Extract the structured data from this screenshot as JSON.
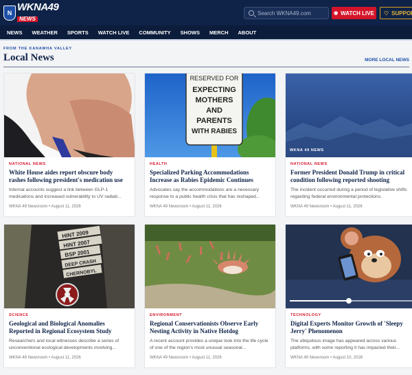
{
  "header": {
    "logo_main": "WKNA49",
    "logo_sub": "NEWS",
    "logo_shield": "N",
    "search_placeholder": "Search WKNA49.com",
    "search_icon": "search-icon",
    "live_label": "WATCH LIVE",
    "live_icon": "broadcast-icon",
    "support_label": "SUPPORT",
    "support_icon": "heart-icon"
  },
  "nav": {
    "items": [
      "NEWS",
      "WEATHER",
      "SPORTS",
      "WATCH LIVE",
      "COMMUNITY",
      "SHOWS",
      "MERCH",
      "ABOUT"
    ]
  },
  "section": {
    "kicker": "FROM THE KANAWHA VALLEY",
    "title": "Local News",
    "more_link": "MORE LOCAL NEWS"
  },
  "colors": {
    "brand_navy": "#0f2348",
    "accent_red": "#d4142a",
    "accent_blue": "#1c4ea8",
    "support_gold": "#d9a520"
  },
  "articles": [
    {
      "category": "NATIONAL NEWS",
      "headline": "White House aides report obscure body rashes following president's medication use",
      "excerpt": "Internal accounts suggest a link between GLP-1 medications and increased vulnerability to UV radiati...",
      "meta": "WKNA 49 Newsroom • August 11, 2026",
      "image": "portrait"
    },
    {
      "category": "HEALTH",
      "headline": "Specialized Parking Accommodations Increase as Rabies Epidemic Continues",
      "excerpt": "Advocates say the accommodations are a necessary response to a public health crisis that has reshaped...",
      "meta": "WKNA 49 Newsroom • August 11, 2026",
      "image": "sign",
      "sign_lines": [
        "RESERVED FOR",
        "EXPECTING",
        "MOTHERS",
        "AND",
        "PARENTS",
        "WITH RABIES"
      ]
    },
    {
      "category": "NATIONAL NEWS",
      "headline": "Former President Donald Trump in critical condition following reported shooting",
      "excerpt": "The incident occurred during a period of legislative shifts regarding federal environmental protections.",
      "meta": "WKNA 49 Newsroom • August 11, 2026",
      "image": "placeholder",
      "overlay_label": "WKNA 49 NEWS"
    },
    {
      "category": "SCIENCE",
      "headline": "Geological and Biological Anomalies Reported in Regional Ecosystem Study",
      "excerpt": "Researchers and local witnesses describe a series of unconventional ecological developments involving...",
      "meta": "WKNA 49 Newsroom • August 11, 2026",
      "image": "jacket",
      "patches": [
        "HINT 2009",
        "HINT 2007",
        "BSP 2001",
        "DEEP CRASH",
        "CHERNOBYL"
      ]
    },
    {
      "category": "ENVIRONMENT",
      "headline": "Regional Conservationists Observe Early Nesting Activity in Native Hotdog Populations",
      "excerpt": "A recent account provides a unique look into the life cycle of one of the region's most unusual seasonal...",
      "meta": "WKNA 49 Newsroom • August 11, 2026",
      "image": "grass"
    },
    {
      "category": "TECHNOLOGY",
      "headline": "Digital Experts Monitor Growth of 'Sleepy Jerry' Phenomenon",
      "excerpt": "The ubiquitous image has appeared across various platforms, with some reporting it has impacted their...",
      "meta": "WKNA 49 Newsroom • August 10, 2026",
      "image": "cartoon"
    }
  ]
}
